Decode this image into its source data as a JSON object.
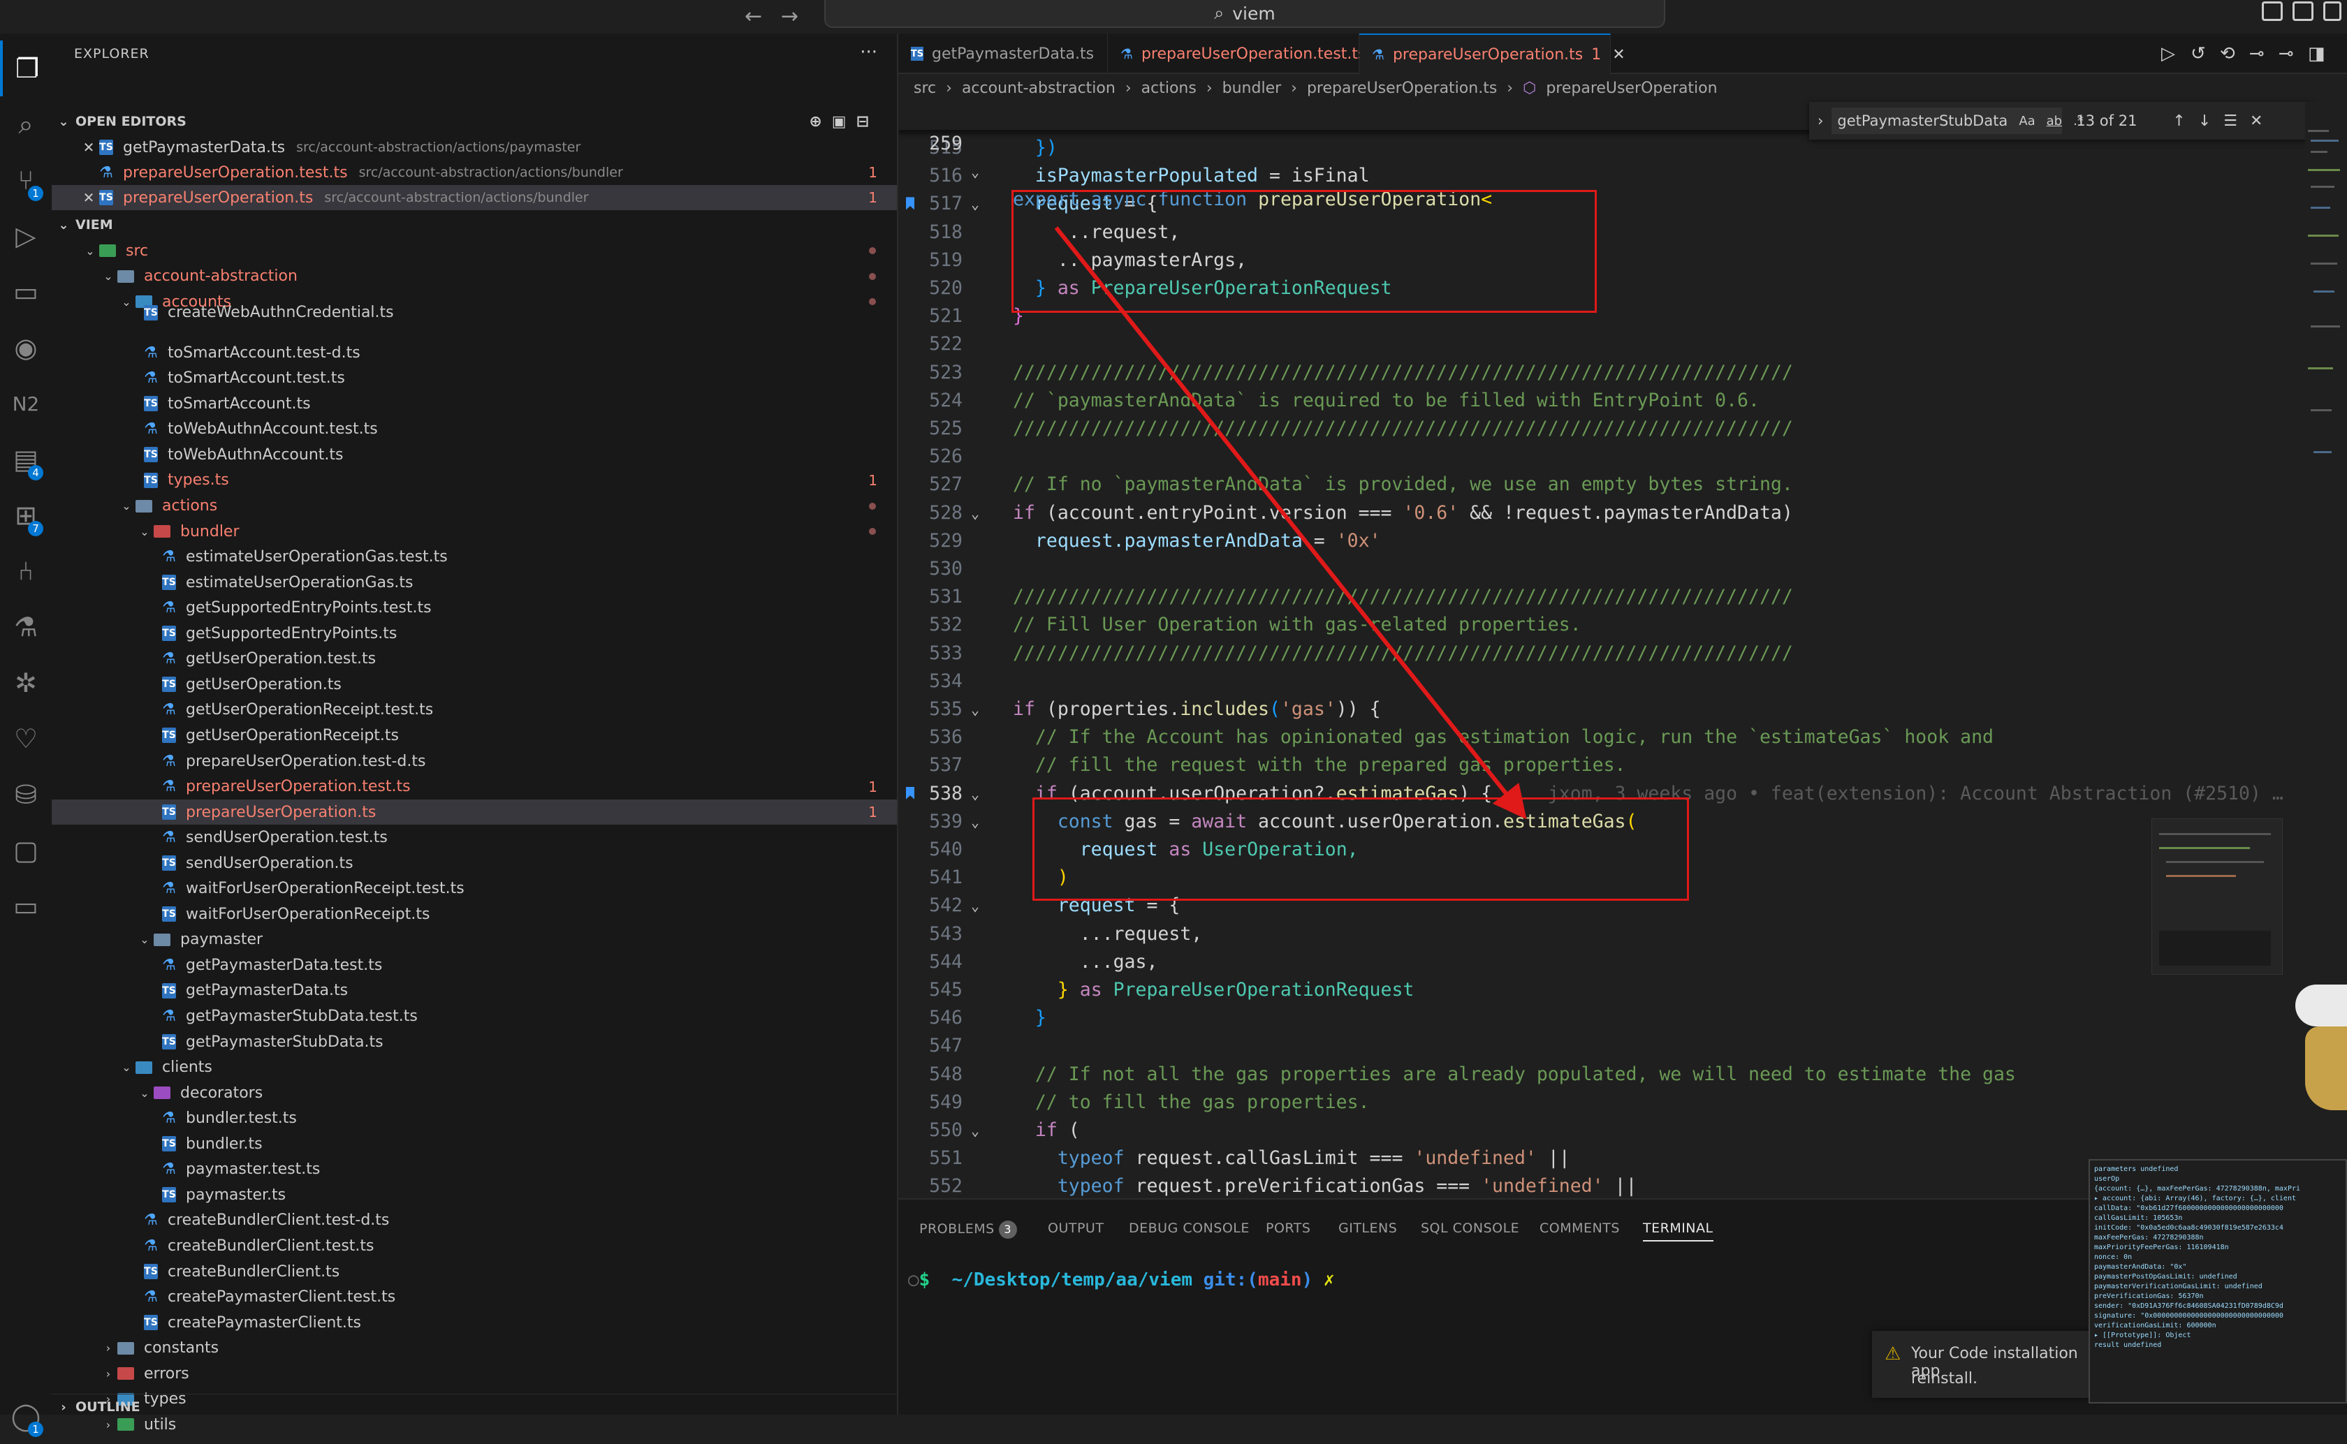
{
  "search": {
    "label": "viem"
  },
  "sidebar": {
    "title": "EXPLORER",
    "open_editors_label": "OPEN EDITORS",
    "viem_label": "VIEM",
    "outline_label": "OUTLINE",
    "open_editors": [
      {
        "name": "getPaymasterData.ts",
        "path": "src/account-abstraction/actions/paymaster",
        "count": ""
      },
      {
        "name": "prepareUserOperation.test.ts",
        "path": "src/account-abstraction/actions/bundler",
        "count": "1"
      },
      {
        "name": "prepareUserOperation.ts",
        "path": "src/account-abstraction/actions/bundler",
        "count": "1"
      }
    ],
    "tree": [
      {
        "label": "src"
      },
      {
        "label": "account-abstraction"
      },
      {
        "label": "accounts"
      },
      {
        "label": "createWebAuthnCredential.ts"
      },
      {
        "label": "toSmartAccount.test-d.ts"
      },
      {
        "label": "toSmartAccount.test.ts"
      },
      {
        "label": "toSmartAccount.ts"
      },
      {
        "label": "toWebAuthnAccount.test.ts"
      },
      {
        "label": "toWebAuthnAccount.ts"
      },
      {
        "label": "types.ts",
        "count": "1"
      },
      {
        "label": "actions"
      },
      {
        "label": "bundler"
      },
      {
        "label": "estimateUserOperationGas.test.ts"
      },
      {
        "label": "estimateUserOperationGas.ts"
      },
      {
        "label": "getSupportedEntryPoints.test.ts"
      },
      {
        "label": "getSupportedEntryPoints.ts"
      },
      {
        "label": "getUserOperation.test.ts"
      },
      {
        "label": "getUserOperation.ts"
      },
      {
        "label": "getUserOperationReceipt.test.ts"
      },
      {
        "label": "getUserOperationReceipt.ts"
      },
      {
        "label": "prepareUserOperation.test-d.ts"
      },
      {
        "label": "prepareUserOperation.test.ts",
        "count": "1"
      },
      {
        "label": "prepareUserOperation.ts",
        "count": "1"
      },
      {
        "label": "sendUserOperation.test.ts"
      },
      {
        "label": "sendUserOperation.ts"
      },
      {
        "label": "waitForUserOperationReceipt.test.ts"
      },
      {
        "label": "waitForUserOperationReceipt.ts"
      },
      {
        "label": "paymaster"
      },
      {
        "label": "getPaymasterData.test.ts"
      },
      {
        "label": "getPaymasterData.ts"
      },
      {
        "label": "getPaymasterStubData.test.ts"
      },
      {
        "label": "getPaymasterStubData.ts"
      },
      {
        "label": "clients"
      },
      {
        "label": "decorators"
      },
      {
        "label": "bundler.test.ts"
      },
      {
        "label": "bundler.ts"
      },
      {
        "label": "paymaster.test.ts"
      },
      {
        "label": "paymaster.ts"
      },
      {
        "label": "createBundlerClient.test-d.ts"
      },
      {
        "label": "createBundlerClient.test.ts"
      },
      {
        "label": "createBundlerClient.ts"
      },
      {
        "label": "createPaymasterClient.test.ts"
      },
      {
        "label": "createPaymasterClient.ts"
      },
      {
        "label": "constants"
      },
      {
        "label": "errors"
      },
      {
        "label": "types"
      },
      {
        "label": "utils"
      }
    ]
  },
  "activity_badges": {
    "scm": "1",
    "remote": "4",
    "extensions": "7",
    "accounts": "1"
  },
  "tabs": [
    {
      "label": "getPaymasterData.ts",
      "mod": ""
    },
    {
      "label": "prepareUserOperation.test.ts",
      "mod": "1"
    },
    {
      "label": "prepareUserOperation.ts",
      "mod": "1"
    }
  ],
  "breadcrumb": [
    "src",
    "account-abstraction",
    "actions",
    "bundler",
    "prepareUserOperation.ts",
    "prepareUserOperation"
  ],
  "find": {
    "query": "getPaymasterStubData",
    "opt_case": "Aa",
    "opt_word": "ab",
    "opt_regex": ".*",
    "result": "13 of 21"
  },
  "sticky": {
    "num": "259",
    "kw1": "export",
    "kw2": "async",
    "kw3": "function",
    "fn": "prepareUserOperation",
    "rest": "<"
  },
  "code_lines": [
    {
      "num": "515",
      "t1": "  })",
      "t2": ""
    },
    {
      "num": "516",
      "t1": "  isPaymasterPopulated",
      "t2": " = isFinal"
    },
    {
      "num": "517",
      "t1": "  request",
      "t2": " = {"
    },
    {
      "num": "518",
      "t1": "    ...request,",
      "t2": ""
    },
    {
      "num": "519",
      "t1": "    ...paymasterArgs,",
      "t2": ""
    },
    {
      "num": "520",
      "t1": "  } ",
      "t2": "as",
      "t3": " PrepareUserOperationRequest"
    },
    {
      "num": "521",
      "t1": "}",
      "t2": ""
    },
    {
      "num": "522",
      "t1": "",
      "t2": ""
    },
    {
      "num": "523",
      "t1": "//////////////////////////////////////////////////////////////////////",
      "t2": ""
    },
    {
      "num": "524",
      "t1": "// `paymasterAndData` is required to be filled with EntryPoint 0.6.",
      "t2": ""
    },
    {
      "num": "525",
      "t1": "//////////////////////////////////////////////////////////////////////",
      "t2": ""
    },
    {
      "num": "526",
      "t1": "",
      "t2": ""
    },
    {
      "num": "527",
      "t1": "// If no `paymasterAndData` is provided, we use an empty bytes string.",
      "t2": ""
    },
    {
      "num": "528",
      "t1": "if",
      "t2": " (account.entryPoint.version === ",
      "t3": "'0.6'",
      "t4": " && !request.paymasterAndData)"
    },
    {
      "num": "529",
      "t1": "  request.paymasterAndData",
      "t2": " = ",
      "t3": "'0x'"
    },
    {
      "num": "530",
      "t1": "",
      "t2": ""
    },
    {
      "num": "531",
      "t1": "//////////////////////////////////////////////////////////////////////",
      "t2": ""
    },
    {
      "num": "532",
      "t1": "// Fill User Operation with gas-related properties.",
      "t2": ""
    },
    {
      "num": "533",
      "t1": "//////////////////////////////////////////////////////////////////////",
      "t2": ""
    },
    {
      "num": "534",
      "t1": "",
      "t2": ""
    },
    {
      "num": "535",
      "t1": "if",
      "t2": " (properties.",
      "t3": "includes",
      "t4": "(",
      "t5": "'gas'",
      "t6": ")) {"
    },
    {
      "num": "536",
      "t1": "  // If the Account has opinionated gas estimation logic, run the `estimateGas` hook and",
      "t2": ""
    },
    {
      "num": "537",
      "t1": "  // fill the request with the prepared gas properties.",
      "t2": ""
    },
    {
      "num": "538",
      "t1": "  if",
      "t2": " (account.userOperation?.",
      "t3": "estimateGas",
      "t4": ") {",
      "blame": "     jxom, 3 weeks ago • feat(extension): Account Abstraction (#2510) …"
    },
    {
      "num": "539",
      "t1": "    const",
      "t2": " gas = ",
      "t3": "await",
      "t4": " account.userOperation.",
      "t5": "estimateGas",
      "t6": "("
    },
    {
      "num": "540",
      "t1": "      request ",
      "t2": "as",
      "t3": " UserOperation,"
    },
    {
      "num": "541",
      "t1": "    )",
      "t2": ""
    },
    {
      "num": "542",
      "t1": "    request",
      "t2": " = {"
    },
    {
      "num": "543",
      "t1": "      ...request,",
      "t2": ""
    },
    {
      "num": "544",
      "t1": "      ...gas,",
      "t2": ""
    },
    {
      "num": "545",
      "t1": "    } ",
      "t2": "as",
      "t3": " PrepareUserOperationRequest"
    },
    {
      "num": "546",
      "t1": "  }",
      "t2": ""
    },
    {
      "num": "547",
      "t1": "",
      "t2": ""
    },
    {
      "num": "548",
      "t1": "  // If not all the gas properties are already populated, we will need to estimate the gas",
      "t2": ""
    },
    {
      "num": "549",
      "t1": "  // to fill the gas properties.",
      "t2": ""
    },
    {
      "num": "550",
      "t1": "  if",
      "t2": " ("
    },
    {
      "num": "551",
      "t1": "    typeof",
      "t2": " request.callGasLimit === ",
      "t3": "'undefined'",
      "t4": " ||"
    },
    {
      "num": "552",
      "t1": "    typeof",
      "t2": " request.preVerificationGas === ",
      "t3": "'undefined'",
      "t4": " ||"
    }
  ],
  "panel": {
    "tabs": [
      "PROBLEMS",
      "OUTPUT",
      "DEBUG CONSOLE",
      "PORTS",
      "GITLENS",
      "SQL CONSOLE",
      "COMMENTS",
      "TERMINAL"
    ],
    "problems_count": "3",
    "terminal": {
      "prompt": "$",
      "path": "~/Desktop/temp/aa/viem",
      "git": "git:(",
      "branch": "main",
      "git_end": ")",
      "mark": "✗"
    }
  },
  "notification": {
    "line1": "Your Code installation app",
    "line2": "reinstall."
  },
  "debug": {
    "lines": [
      "parameters undefined",
      "userOp",
      "  {account: {…}, maxFeePerGas: 47278290388n, maxPri",
      "  ▸ account: {abi: Array(46), factory: {…}, client",
      "    callData: \"0xb61d27f6000000000000000000000000",
      "    callGasLimit: 105653n",
      "    initCode: \"0x0a5ed0c6aa8c49030f819e587e2633c4",
      "    maxFeePerGas: 47278290388n",
      "    maxPriorityFeePerGas: 116109418n",
      "    nonce: 0n",
      "    paymasterAndData: \"0x\"",
      "    paymasterPostOpGasLimit: undefined",
      "    paymasterVerificationGasLimit: undefined",
      "    preVerificationGas: 56370n",
      "    sender: \"0xD91A376Ff6c84608SA04231fD0789d8C9d",
      "    signature: \"0x0000000000000000000000000000000",
      "    verificationGasLimit: 600000n",
      "  ▸ [[Prototype]]: Object",
      "result undefined"
    ]
  }
}
